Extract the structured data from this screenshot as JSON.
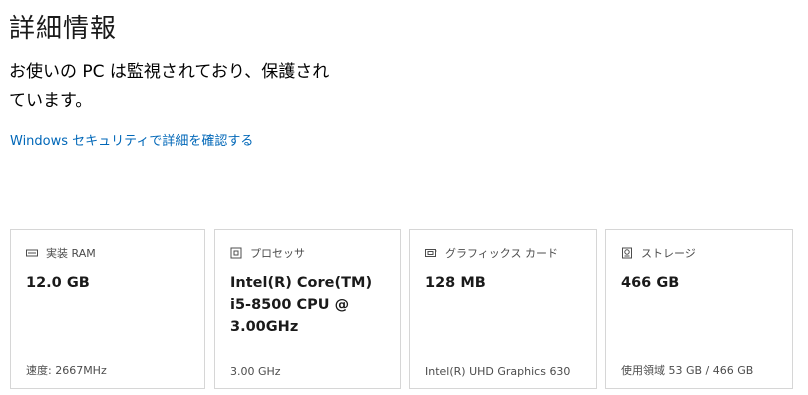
{
  "page": {
    "title": "詳細情報",
    "status_text": "お使いの PC は監視されており、保護されています。",
    "security_link": "Windows セキュリティで詳細を確認する"
  },
  "cards": [
    {
      "label": "実装 RAM",
      "icon": "memory-icon",
      "value": "12.0 GB",
      "detail": "速度: 2667MHz"
    },
    {
      "label": "プロセッサ",
      "icon": "processor-icon",
      "value": "Intel(R) Core(TM) i5-8500 CPU @ 3.00GHz",
      "detail": "3.00 GHz"
    },
    {
      "label": "グラフィックス カード",
      "icon": "graphics-card-icon",
      "value": "128 MB",
      "detail": "Intel(R) UHD Graphics 630"
    },
    {
      "label": "ストレージ",
      "icon": "storage-icon",
      "value": "466 GB",
      "detail": "使用領域 53 GB / 466 GB"
    }
  ],
  "colors": {
    "link": "#0067b8",
    "card_border": "#d6d6d6",
    "secondary_text": "#4c4c4c"
  }
}
